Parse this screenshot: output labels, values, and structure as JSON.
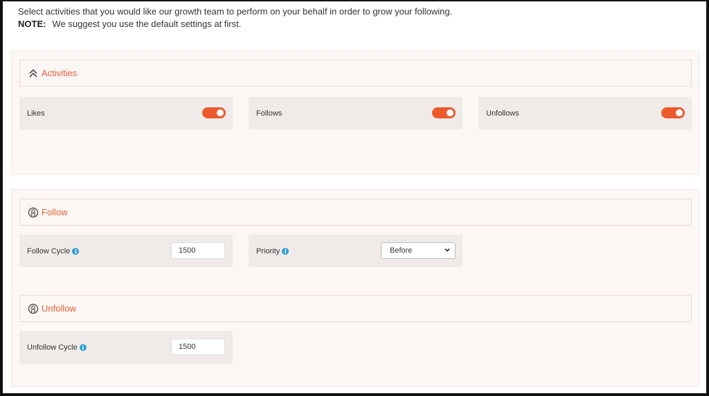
{
  "intro": {
    "description": "Select activities that you would like our growth team to perform on your behalf in order to grow your following.",
    "note_label": "NOTE:",
    "note_text": "We suggest you use the default settings at first."
  },
  "activities": {
    "title": "Activities",
    "icon": "double-chevron-up-icon",
    "items": [
      {
        "label": "Likes",
        "enabled": true
      },
      {
        "label": "Follows",
        "enabled": true
      },
      {
        "label": "Unfollows",
        "enabled": true
      }
    ]
  },
  "follow": {
    "title": "Follow",
    "icon": "user-circle-icon",
    "cycle_label": "Follow Cycle",
    "cycle_value": "1500",
    "priority_label": "Priority",
    "priority_value": "Before"
  },
  "unfollow": {
    "title": "Unfollow",
    "icon": "user-circle-icon",
    "cycle_label": "Unfollow Cycle",
    "cycle_value": "1500"
  },
  "colors": {
    "accent": "#ec5a2d",
    "title": "#e85f38",
    "info": "#2e9fd9",
    "section_bg": "#fcf7f4",
    "card_bg": "#f0ebe8"
  }
}
